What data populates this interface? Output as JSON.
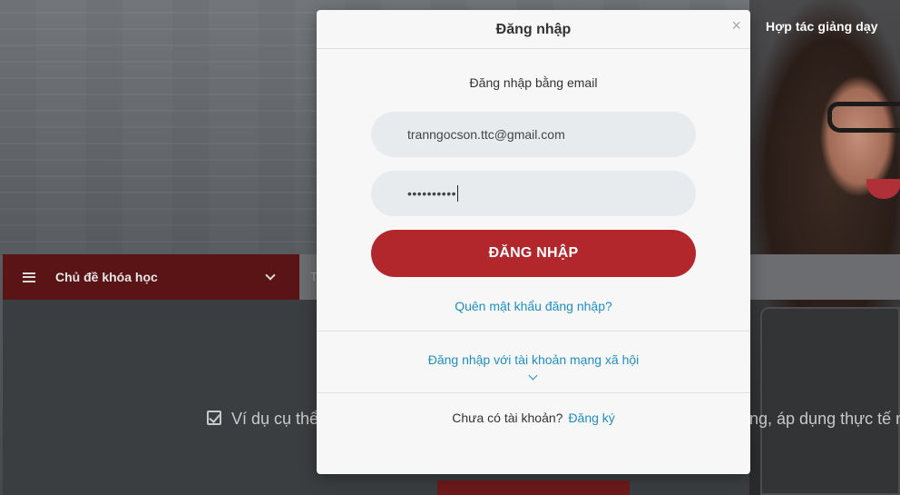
{
  "background": {
    "nav_link": "Hợp tác giảng dạy",
    "topic_menu_label": "Chủ đề khóa học",
    "search_placeholder": "T",
    "content_text_left": "Ví dụ cụ thể",
    "content_text_right": "ng, áp dụng thực tế n"
  },
  "modal": {
    "title": "Đăng nhập",
    "close_symbol": "×",
    "subtitle": "Đăng nhập bằng email",
    "email_value": "tranngocson.ttc@gmail.com",
    "password_masked": "••••••••••",
    "login_button": "ĐĂNG NHẬP",
    "forgot_password": "Quên mật khẩu đăng nhập?",
    "social_login": "Đăng nhập với tài khoản mạng xã hội",
    "no_account": "Chưa có tài khoản?",
    "signup_link": "Đăng ký"
  },
  "colors": {
    "primary_red": "#b1272c",
    "link_blue": "#1e8fc4",
    "field_bg": "#e8ebee",
    "modal_bg": "#f7f7f7"
  }
}
